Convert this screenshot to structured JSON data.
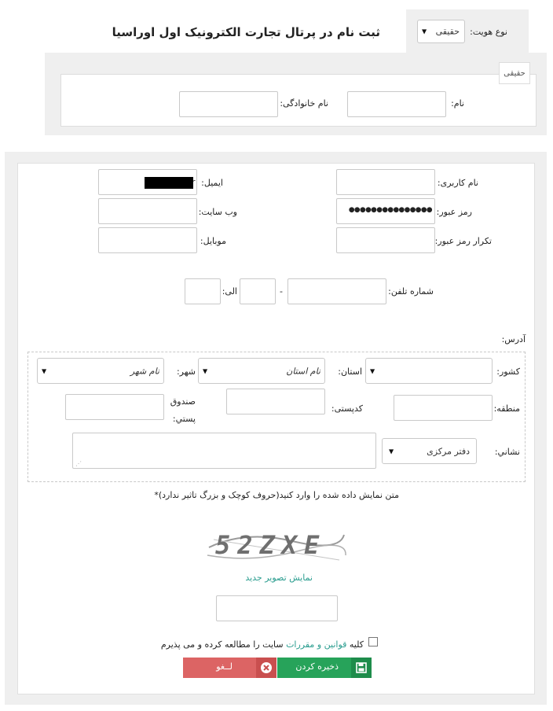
{
  "header": {
    "title": "ثبت نام در پرتال تجارت الکترونیک اول اوراسیا",
    "identity_type_label": "نوع هویت:",
    "identity_type_value": "حقیقی"
  },
  "identity_panel": {
    "legend": "حقیقی",
    "first_name_label": "نام:",
    "first_name_value": "",
    "last_name_label": "نام خانوادگی:",
    "last_name_value": ""
  },
  "account": {
    "username_label": "نام کاربری:",
    "username_value": "",
    "email_label": "ایمیل:",
    "email_value": "r",
    "password_label": "رمز عبور:",
    "password_value": "●●●●●●●●●●●●●●●",
    "website_label": "وب سایت:",
    "website_value": "",
    "confirm_password_label": "تکرار رمز عبور:",
    "confirm_password_value": "",
    "mobile_label": "موبایل:",
    "mobile_value": ""
  },
  "phone": {
    "label": "شماره تلفن:",
    "dash": "-",
    "to_label": "الی:",
    "number_value": "",
    "code_value": "",
    "ext_value": ""
  },
  "address": {
    "title": "آدرس:",
    "country_label": "کشور:",
    "country_value": "",
    "province_label": "استان:",
    "province_value": "نام استان",
    "city_label": "شهر:",
    "city_value": "نام شهر",
    "region_label": "منطقه:",
    "region_value": "",
    "postal_code_label": "کدپستی:",
    "postal_code_value": "",
    "po_box_label_line1": "صندوق",
    "po_box_label_line2": "پستي:",
    "po_box_value": "",
    "address_label": "نشاني:",
    "address_type_value": "دفتر مرکزی",
    "address_value": ""
  },
  "captcha": {
    "instruction": "متن نمایش داده شده را وارد کنید(حروف کوچک و بزرگ تاثیر ندارد)*",
    "image_text": "52ZXE",
    "new_image_link": "نمایش تصویر جدید",
    "input_value": ""
  },
  "terms": {
    "prefix": "کلیه",
    "link": "قوانین و مقررات",
    "suffix": "سایت را مطالعه کرده و می پذیرم"
  },
  "actions": {
    "save_label": "ذخیره کردن",
    "cancel_label": "لــغو"
  },
  "colors": {
    "save": "#27a35a",
    "cancel": "#dc6464",
    "link": "#2a9d8f"
  },
  "icons": {
    "save": "floppy-disk-icon",
    "cancel": "close-circle-icon"
  }
}
